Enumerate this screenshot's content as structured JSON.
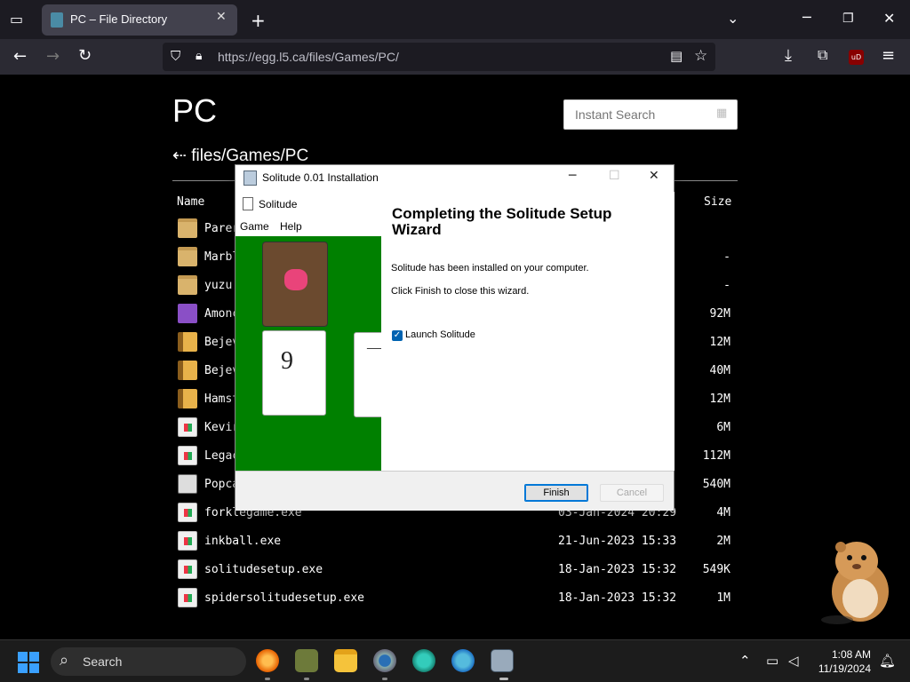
{
  "browser": {
    "tab_title": "PC – File Directory",
    "url": "https://egg.l5.ca/files/Games/PC/"
  },
  "page": {
    "title": "PC",
    "search_placeholder": "Instant Search",
    "breadcrumb": "⇠ files/Games/PC",
    "columns": {
      "name": "Name",
      "size": "Size"
    },
    "files": [
      {
        "name": "Parer",
        "date": "",
        "size": "",
        "icon": "folder-icon"
      },
      {
        "name": "Marbl",
        "date": "",
        "size": "-",
        "icon": "folder-icon"
      },
      {
        "name": "yuzu",
        "date": "",
        "size": "-",
        "icon": "folder-icon"
      },
      {
        "name": "Amonc",
        "date": "",
        "size": "92M",
        "icon": "archive-icon"
      },
      {
        "name": "Bejev",
        "date": "",
        "size": "12M",
        "icon": "zip-icon"
      },
      {
        "name": "Bejev",
        "date": "",
        "size": "40M",
        "icon": "zip-icon"
      },
      {
        "name": "Hamst",
        "date": "",
        "size": "12M",
        "icon": "zip-icon"
      },
      {
        "name": "Kevir",
        "date": "",
        "size": "6M",
        "icon": "exe-icon"
      },
      {
        "name": "Legac",
        "date": "",
        "size": "112M",
        "icon": "exe-icon"
      },
      {
        "name": "Popca",
        "date": "",
        "size": "540M",
        "icon": "installer-icon"
      },
      {
        "name": "forklegame.exe",
        "date": "03-Jan-2024 20:29",
        "size": "4M",
        "icon": "exe-icon"
      },
      {
        "name": "inkball.exe",
        "date": "21-Jun-2023 15:33",
        "size": "2M",
        "icon": "exe-icon"
      },
      {
        "name": "solitudesetup.exe",
        "date": "18-Jan-2023 15:32",
        "size": "549K",
        "icon": "exe-icon"
      },
      {
        "name": "spidersolitudesetup.exe",
        "date": "18-Jan-2023 15:32",
        "size": "1M",
        "icon": "exe-icon"
      }
    ]
  },
  "dialog": {
    "title": "Solitude 0.01 Installation",
    "game_window_title": "Solitude",
    "menu": [
      "Game",
      "Help"
    ],
    "card_values": [
      "9",
      "—"
    ],
    "heading": "Completing the Solitude Setup Wizard",
    "line1": "Solitude has been installed on your computer.",
    "line2": "Click Finish to close this wizard.",
    "checkbox_label": "Launch Solitude",
    "checkbox_checked": true,
    "finish": "Finish",
    "cancel": "Cancel"
  },
  "taskbar": {
    "search_label": "Search",
    "time": "1:08 AM",
    "date": "11/19/2024"
  }
}
